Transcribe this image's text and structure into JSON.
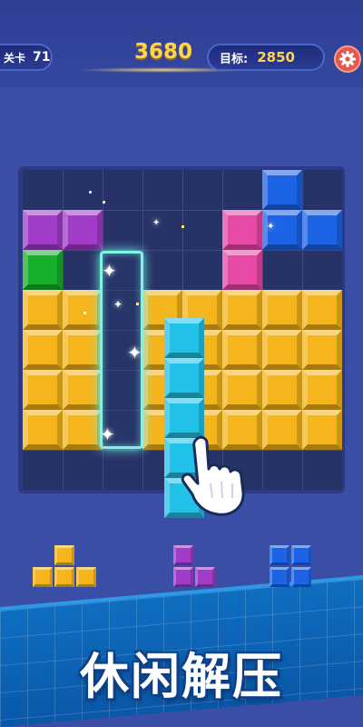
{
  "header": {
    "level_label": "关卡",
    "level_value": "71",
    "score": "3680",
    "goal_label": "目标:",
    "goal_value": "2850",
    "settings_icon": "gear-icon"
  },
  "colors": {
    "yellow": "#f5b51d",
    "purple": "#a03cc8",
    "pink": "#e64aa6",
    "blue": "#1d63e6",
    "green": "#18b02a",
    "cyan": "#22c2e8",
    "accent": "#ffd54a",
    "settings": "#e4574a"
  },
  "board": {
    "rows": 8,
    "cols": 8,
    "grid": [
      [
        "",
        "",
        "",
        "",
        "",
        "",
        "blue",
        ""
      ],
      [
        "purple",
        "purple",
        "",
        "",
        "",
        "pink",
        "blue",
        "blue"
      ],
      [
        "green",
        "",
        "",
        "",
        "",
        "pink",
        "",
        ""
      ],
      [
        "yellow",
        "yellow",
        "",
        "yellow",
        "yellow",
        "yellow",
        "yellow",
        "yellow"
      ],
      [
        "yellow",
        "yellow",
        "",
        "yellow",
        "yellow",
        "yellow",
        "yellow",
        "yellow"
      ],
      [
        "yellow",
        "yellow",
        "",
        "yellow",
        "yellow",
        "yellow",
        "yellow",
        "yellow"
      ],
      [
        "yellow",
        "yellow",
        "",
        "yellow",
        "yellow",
        "yellow",
        "yellow",
        "yellow"
      ],
      [
        "",
        "",
        "",
        "",
        "",
        "",
        "",
        ""
      ]
    ],
    "highlight_column": 2
  },
  "dragged_piece": {
    "color": "cyan",
    "length": 5,
    "hand_icon": "pointing-hand-icon"
  },
  "pieces": [
    {
      "name": "piece-t-yellow",
      "color": "yellow",
      "cells": [
        [
          0,
          1
        ],
        [
          1,
          0
        ],
        [
          1,
          1
        ],
        [
          1,
          2
        ]
      ]
    },
    {
      "name": "piece-l-purple",
      "color": "purple",
      "cells": [
        [
          0,
          0
        ],
        [
          1,
          0
        ],
        [
          1,
          1
        ]
      ]
    },
    {
      "name": "piece-square-blue",
      "color": "blue",
      "cells": [
        [
          0,
          0
        ],
        [
          0,
          1
        ],
        [
          1,
          0
        ],
        [
          1,
          1
        ]
      ]
    }
  ],
  "banner": {
    "slogan": "休闲解压"
  }
}
